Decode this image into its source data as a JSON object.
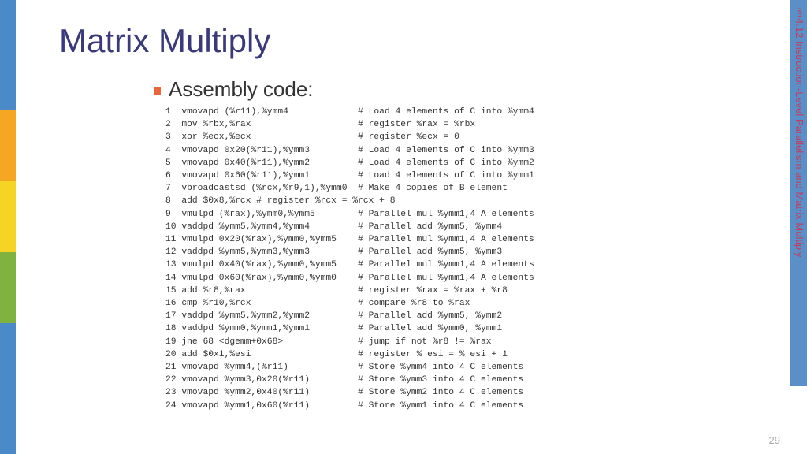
{
  "title": "Matrix Multiply",
  "subtitle": "Assembly code:",
  "sidetab": "§4.12 Instruction-Level Parallelism and Matrix Multiply",
  "page_number": "29",
  "code_lines": [
    {
      "n": "1",
      "instr": "vmovapd (%r11),%ymm4",
      "comment": "# Load 4 elements of C into %ymm4"
    },
    {
      "n": "2",
      "instr": "mov %rbx,%rax",
      "comment": "# register %rax = %rbx"
    },
    {
      "n": "3",
      "instr": "xor %ecx,%ecx",
      "comment": "# register %ecx = 0"
    },
    {
      "n": "4",
      "instr": "vmovapd 0x20(%r11),%ymm3",
      "comment": "# Load 4 elements of C into %ymm3"
    },
    {
      "n": "5",
      "instr": "vmovapd 0x40(%r11),%ymm2",
      "comment": "# Load 4 elements of C into %ymm2"
    },
    {
      "n": "6",
      "instr": "vmovapd 0x60(%r11),%ymm1",
      "comment": "# Load 4 elements of C into %ymm1"
    },
    {
      "n": "7",
      "instr": "vbroadcastsd (%rcx,%r9,1),%ymm0",
      "comment": "# Make 4 copies of B element"
    },
    {
      "n": "8",
      "instr": "add $0x8,%rcx # register %rcx = %rcx + 8",
      "comment": ""
    },
    {
      "n": "9",
      "instr": "vmulpd (%rax),%ymm0,%ymm5",
      "comment": "# Parallel mul %ymm1,4 A elements"
    },
    {
      "n": "10",
      "instr": "vaddpd %ymm5,%ymm4,%ymm4",
      "comment": "# Parallel add %ymm5, %ymm4"
    },
    {
      "n": "11",
      "instr": "vmulpd 0x20(%rax),%ymm0,%ymm5",
      "comment": "# Parallel mul %ymm1,4 A elements"
    },
    {
      "n": "12",
      "instr": "vaddpd %ymm5,%ymm3,%ymm3",
      "comment": "# Parallel add %ymm5, %ymm3"
    },
    {
      "n": "13",
      "instr": "vmulpd 0x40(%rax),%ymm0,%ymm5",
      "comment": "# Parallel mul %ymm1,4 A elements"
    },
    {
      "n": "14",
      "instr": "vmulpd 0x60(%rax),%ymm0,%ymm0",
      "comment": "# Parallel mul %ymm1,4 A elements"
    },
    {
      "n": "15",
      "instr": "add %r8,%rax",
      "comment": "# register %rax = %rax + %r8"
    },
    {
      "n": "16",
      "instr": "cmp %r10,%rcx",
      "comment": "# compare %r8 to %rax"
    },
    {
      "n": "17",
      "instr": "vaddpd %ymm5,%ymm2,%ymm2",
      "comment": "# Parallel add %ymm5, %ymm2"
    },
    {
      "n": "18",
      "instr": "vaddpd %ymm0,%ymm1,%ymm1",
      "comment": "# Parallel add %ymm0, %ymm1"
    },
    {
      "n": "19",
      "instr": "jne 68 <dgemm+0x68>",
      "comment": "# jump if not %r8 != %rax"
    },
    {
      "n": "20",
      "instr": "add $0x1,%esi",
      "comment": "# register % esi = % esi + 1"
    },
    {
      "n": "21",
      "instr": "vmovapd %ymm4,(%r11)",
      "comment": "# Store %ymm4 into 4 C elements"
    },
    {
      "n": "22",
      "instr": "vmovapd %ymm3,0x20(%r11)",
      "comment": "# Store %ymm3 into 4 C elements"
    },
    {
      "n": "23",
      "instr": "vmovapd %ymm2,0x40(%r11)",
      "comment": "# Store %ymm2 into 4 C elements"
    },
    {
      "n": "24",
      "instr": "vmovapd %ymm1,0x60(%r11)",
      "comment": "# Store %ymm1 into 4 C elements"
    }
  ]
}
